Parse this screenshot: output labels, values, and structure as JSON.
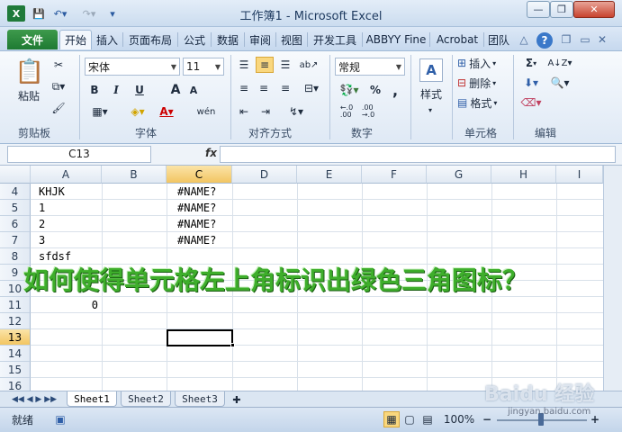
{
  "window": {
    "title": "工作簿1 - Microsoft Excel",
    "app_icon_letter": "X",
    "quick_access": [
      "save-icon",
      "undo-icon",
      "redo-icon",
      "customize-icon"
    ],
    "controls": [
      "minimize",
      "restore",
      "close"
    ],
    "controls_glyphs": {
      "minimize": "—",
      "restore": "❐",
      "close": "✕"
    },
    "ribbon_controls_glyphs": {
      "minimize": "△",
      "help": "?",
      "restore": "❐",
      "close": "✕"
    }
  },
  "tabs": {
    "file": "文件",
    "home": "开始",
    "insert": "插入",
    "page_layout": "页面布局",
    "formulas": "公式",
    "data": "数据",
    "review": "审阅",
    "view": "视图",
    "developer": "开发工具",
    "abbyy": "ABBYY Fine",
    "acrobat": "Acrobat",
    "team": "团队"
  },
  "ribbon": {
    "clipboard": {
      "label": "剪贴板",
      "paste": "粘贴"
    },
    "font": {
      "label": "字体",
      "name": "宋体",
      "size": "11",
      "bold": "B",
      "italic": "I",
      "underline": "U",
      "grow": "A",
      "shrink": "A",
      "wen": "wén"
    },
    "alignment": {
      "label": "对齐方式"
    },
    "number": {
      "label": "数字",
      "format": "常规",
      "percent": "%",
      "comma": ",",
      "inc_decimal": "+.0 .00",
      "dec_decimal": ".00 →.0"
    },
    "styles": {
      "label": "样式"
    },
    "cells": {
      "label": "单元格",
      "insert": "插入",
      "delete": "删除",
      "format": "格式"
    },
    "editing": {
      "label": "编辑",
      "sum": "Σ"
    }
  },
  "formula_bar": {
    "name_box": "C13",
    "fx": "fx",
    "value": ""
  },
  "columns": [
    "A",
    "B",
    "C",
    "D",
    "E",
    "F",
    "G",
    "H",
    "I"
  ],
  "active_column": "C",
  "rows": [
    4,
    5,
    6,
    7,
    8,
    9,
    10,
    11,
    12,
    13,
    14,
    15,
    16
  ],
  "active_row": 13,
  "cells": {
    "A4": "KHJK",
    "C4": "#NAME?",
    "A5": "1",
    "C5": "#NAME?",
    "A6": "2",
    "C6": "#NAME?",
    "A7": "3",
    "C7": "#NAME?",
    "A8": "sfdsf",
    "A11": "0"
  },
  "sheets": [
    "Sheet1",
    "Sheet2",
    "Sheet3"
  ],
  "active_sheet": "Sheet1",
  "status": {
    "ready": "就绪",
    "zoom": "100%"
  },
  "overlay_text": "如何使得单元格左上角标识出绿色三角图标？",
  "watermark": "Baidu 经验",
  "watermark_url": "jingyan.baidu.com",
  "colors": {
    "file_tab": "#2a8a3c",
    "overlay_text": "#3eae2b",
    "active_header": "#f2c562"
  }
}
